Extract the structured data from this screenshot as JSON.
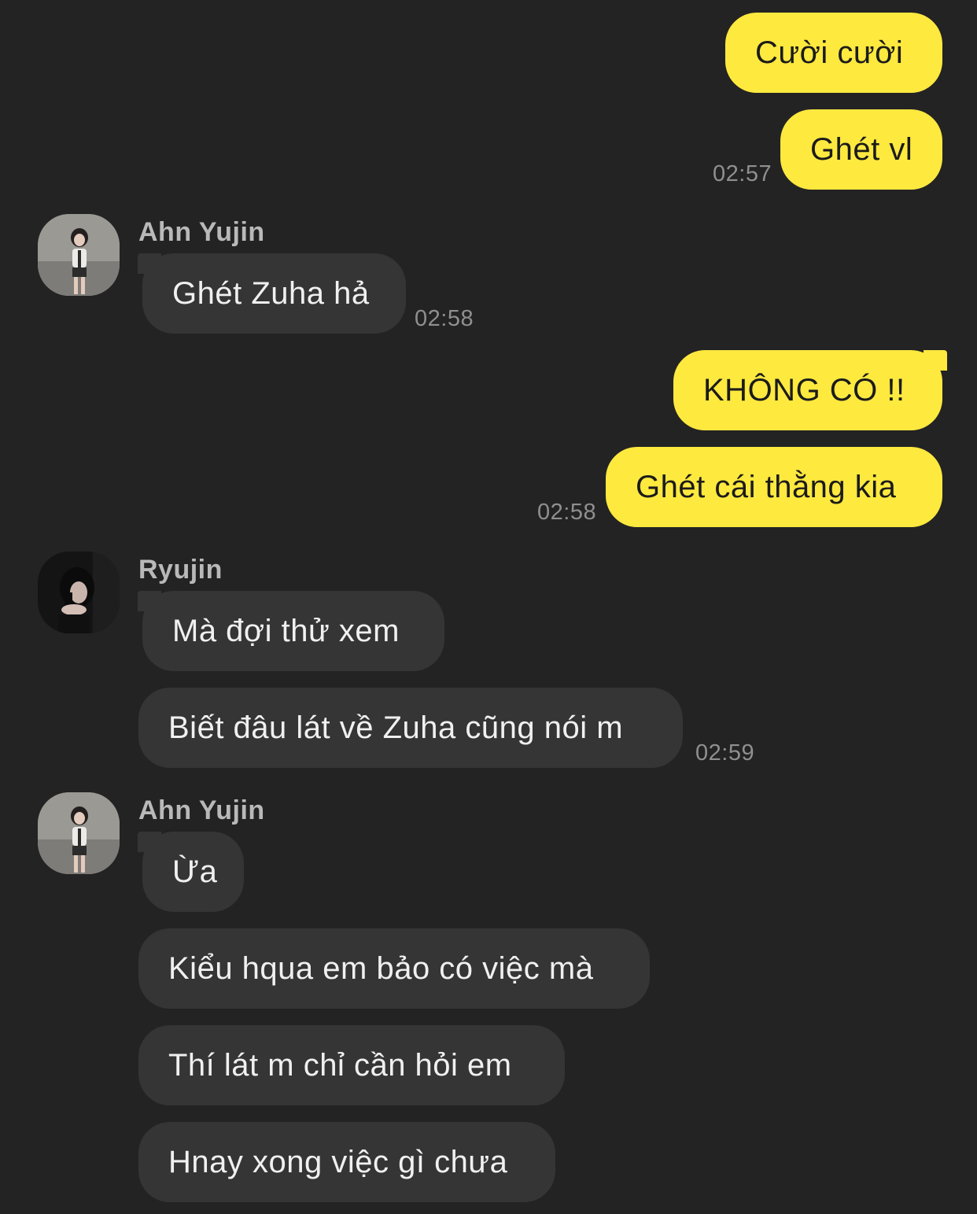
{
  "messages": {
    "m1": "Cười cười",
    "m2": "Ghét vl",
    "t1": "02:57",
    "g1_sender": "Ahn Yujin",
    "m3": "Ghét Zuha hả",
    "t2": "02:58",
    "m4": "KHÔNG CÓ !!",
    "m5": "Ghét cái thằng kia",
    "t3": "02:58",
    "g2_sender": "Ryujin",
    "m6": "Mà đợi thử xem",
    "m7": "Biết đâu lát về Zuha cũng nói m",
    "t4": "02:59",
    "g3_sender": "Ahn Yujin",
    "m8": "Ừa",
    "m9": "Kiểu hqua em bảo có việc mà",
    "m10": "Thí lát m chỉ cần hỏi em",
    "m11": "Hnay xong việc gì chưa"
  },
  "avatars": {
    "a1": "avatar-ahn-yujin",
    "a2": "avatar-ryujin",
    "a3": "avatar-ahn-yujin"
  },
  "colors": {
    "background": "#232323",
    "outgoing_bubble": "#fee93f",
    "incoming_bubble": "#353535",
    "timestamp": "#8f8f8f",
    "sender_name": "#b9b9b9"
  }
}
